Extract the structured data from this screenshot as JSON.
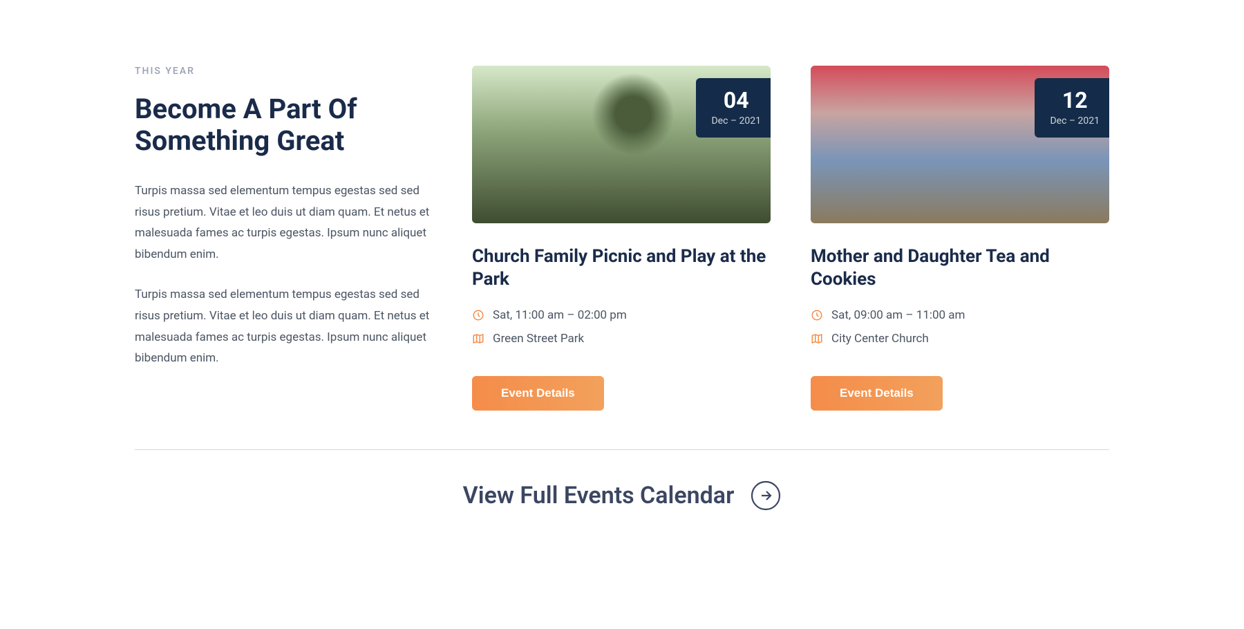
{
  "section": {
    "eyebrow": "THIS YEAR",
    "title": "Become A Part Of Something Great",
    "paragraph1": "Turpis massa sed elementum tempus egestas sed sed risus pretium. Vitae et leo duis ut diam quam. Et netus et malesuada fames ac turpis egestas. Ipsum nunc aliquet bibendum enim.",
    "paragraph2": "Turpis massa sed elementum tempus egestas sed sed risus pretium. Vitae et leo duis ut diam quam. Et netus et malesuada fames ac turpis egestas. Ipsum nunc aliquet bibendum enim."
  },
  "events": [
    {
      "date_day": "04",
      "date_sub": "Dec – 2021",
      "title": "Church Family Picnic and Play at the Park",
      "time": "Sat, 11:00 am – 02:00 pm",
      "location": "Green Street Park",
      "button": "Event Details"
    },
    {
      "date_day": "12",
      "date_sub": "Dec – 2021",
      "title": "Mother and Daughter Tea and Cookies",
      "time": "Sat, 09:00 am – 11:00 am",
      "location": "City Center Church",
      "button": "Event Details"
    }
  ],
  "footer_link": "View Full Events Calendar",
  "colors": {
    "accent": "#f58c4a",
    "dark_navy": "#142c4a",
    "text_primary": "#1a2b4a",
    "text_body": "#4b5563"
  }
}
